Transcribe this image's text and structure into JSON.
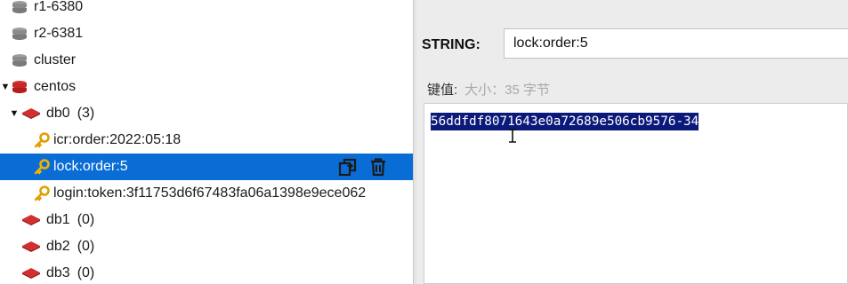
{
  "tree": {
    "connections": [
      {
        "label": "r1-6380"
      },
      {
        "label": "r2-6381"
      },
      {
        "label": "cluster"
      },
      {
        "label": "centos"
      }
    ],
    "db0": {
      "label": "db0",
      "count": "(3)"
    },
    "keys": [
      {
        "label": "icr:order:2022:05:18"
      },
      {
        "label": "lock:order:5"
      },
      {
        "label": "login:token:3f11753d6f67483fa06a1398e9ece062"
      }
    ],
    "dbs": [
      {
        "label": "db1",
        "count": "(0)"
      },
      {
        "label": "db2",
        "count": "(0)"
      },
      {
        "label": "db3",
        "count": "(0)"
      }
    ]
  },
  "detail": {
    "type_label": "STRING:",
    "key_name": "lock:order:5",
    "value_caption": "键值:",
    "value_size": "大小：35 字节",
    "value": "56ddfdf8071643e0a72689e506cb9576-34"
  },
  "colors": {
    "selection": "#0a6dd6",
    "value_highlight": "#0b1a7a",
    "db_icon": "#c62828",
    "key_icon": "#e0a000"
  },
  "icons": {
    "server": "server-stack-icon",
    "database": "database-icon",
    "key": "key-icon",
    "copy": "copy-icon",
    "delete": "trash-icon"
  }
}
